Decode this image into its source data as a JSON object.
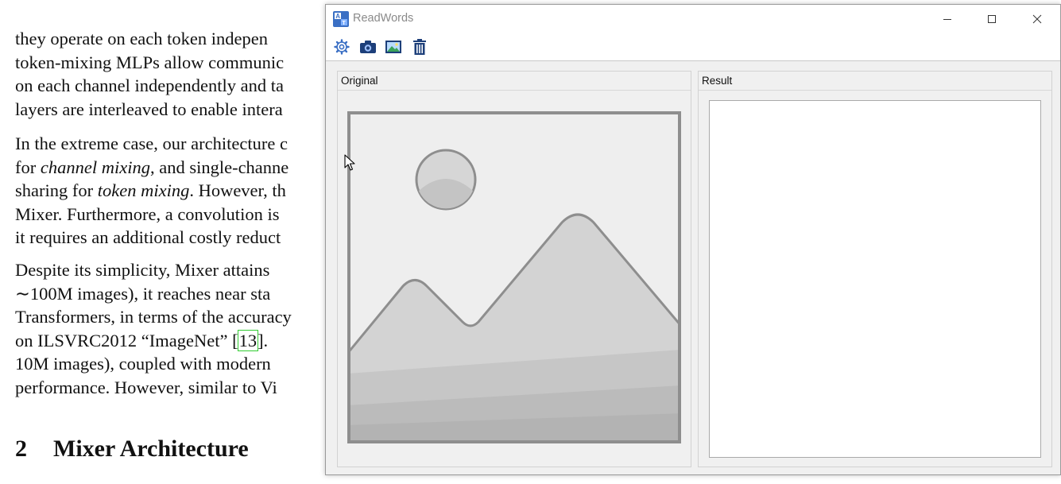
{
  "paper": {
    "paragraphs": [
      {
        "lines": [
          "they operate on each token indepen",
          "token-mixing MLPs allow communic",
          "on each channel independently and ta",
          "layers are interleaved to enable intera"
        ]
      },
      {
        "lines": [
          "In the extreme case, our architecture c",
          "for |channel mixing|, and single-channe",
          "sharing for |token mixing|. However, th",
          "Mixer. Furthermore, a convolution is",
          "it requires an additional costly reduct"
        ]
      },
      {
        "lines": [
          "Despite its simplicity, Mixer attains",
          "∼100M images), it reaches near sta",
          "Transformers, in terms of the accuracy",
          "on ILSVRC2012 “ImageNet” [13].",
          "10M images), coupled with modern",
          "performance. However, similar to Vi"
        ]
      }
    ],
    "citation": "13",
    "heading": {
      "number": "2",
      "title": "Mixer Architecture"
    }
  },
  "window": {
    "title": "ReadWords",
    "controls": {
      "minimize": "minimize-icon",
      "maximize": "maximize-icon",
      "close": "close-icon"
    },
    "toolbar": [
      {
        "name": "settings-button",
        "icon": "gear-icon"
      },
      {
        "name": "camera-button",
        "icon": "camera-icon"
      },
      {
        "name": "open-image-button",
        "icon": "image-icon"
      },
      {
        "name": "clear-button",
        "icon": "trash-icon"
      }
    ],
    "panels": {
      "original": {
        "title": "Original",
        "icon": "image-placeholder-icon"
      },
      "result": {
        "title": "Result",
        "text": ""
      }
    },
    "colors": {
      "accent": "#3a6fc4",
      "toolbar_icon": "#1d3f7a",
      "title_text": "#8a8a8a"
    }
  }
}
